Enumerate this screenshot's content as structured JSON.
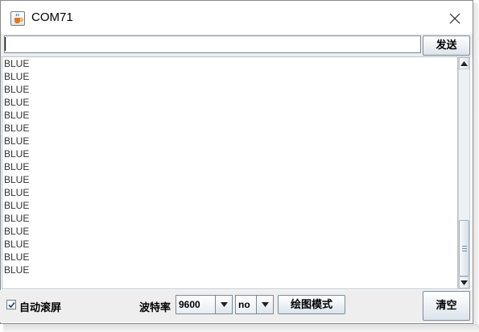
{
  "window": {
    "title": "COM71",
    "app_icon": "java-coffee-cup-icon",
    "close_icon": "close-icon"
  },
  "send_bar": {
    "input_value": "",
    "send_label": "发送"
  },
  "output": {
    "lines": [
      "BLUE",
      "BLUE",
      "BLUE",
      "BLUE",
      "BLUE",
      "BLUE",
      "BLUE",
      "BLUE",
      "BLUE",
      "BLUE",
      "BLUE",
      "BLUE",
      "BLUE",
      "BLUE",
      "BLUE",
      "BLUE",
      "BLUE"
    ]
  },
  "scrollbar": {
    "position_percent": 100
  },
  "bottom_bar": {
    "autoscroll_label": "自动滚屏",
    "autoscroll_checked": true,
    "baud_label": "波特率",
    "baud_value": "9600",
    "line_ending_value": "no",
    "plot_mode_label": "绘图模式",
    "clear_label": "清空"
  },
  "colors": {
    "panel_background": "#eeeeee",
    "output_text": "#333333",
    "button_border": "#7a8a99"
  }
}
